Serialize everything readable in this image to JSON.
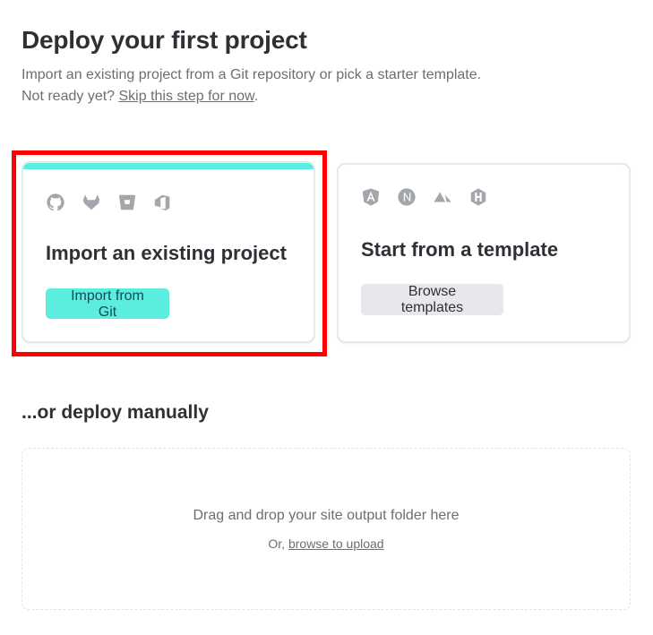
{
  "header": {
    "title": "Deploy your first project",
    "subtitle": "Import an existing project from a Git repository or pick a starter template.",
    "not_ready_prefix": "Not ready yet? ",
    "skip_link": "Skip this step for now",
    "not_ready_suffix": "."
  },
  "cards": {
    "import": {
      "icons": [
        "github-icon",
        "gitlab-icon",
        "bitbucket-icon",
        "azure-devops-icon"
      ],
      "title": "Import an existing project",
      "button_label": "Import from Git",
      "accent_color": "#5bede0"
    },
    "template": {
      "icons": [
        "angular-icon",
        "nextjs-icon",
        "nuxt-icon",
        "hugo-icon"
      ],
      "title": "Start from a template",
      "button_label": "Browse templates"
    }
  },
  "manual": {
    "title": "...or deploy manually",
    "dropzone_text": "Drag and drop your site output folder here",
    "or_prefix": "Or, ",
    "browse_link": "browse to upload"
  },
  "highlight_color": "#ff0000",
  "icon_color": "#a3a6ab"
}
